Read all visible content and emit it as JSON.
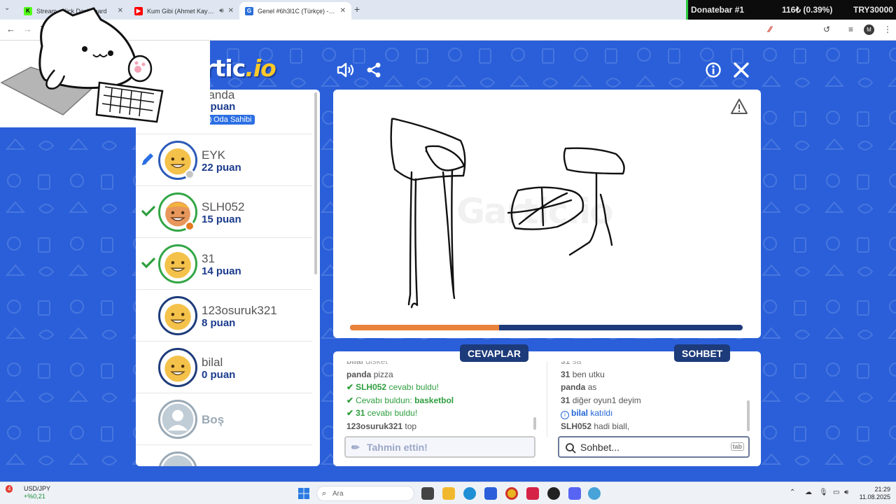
{
  "browser": {
    "tabs": [
      {
        "title": "Stream - Kick Dashboard",
        "favicon_color": "#53fc18",
        "favicon_glyph": "K"
      },
      {
        "title": "Kum Gibi (Ahmet Kaya) - Yo",
        "favicon_color": "#ff0000",
        "favicon_glyph": "▶"
      },
      {
        "title": "Genel #6h3l1C (Türkçe) - Gartic",
        "favicon_color": "#2a6fd9",
        "favicon_glyph": "G"
      }
    ],
    "new_tab": "+",
    "profile_initial": "M"
  },
  "donate": {
    "label": "Donatebar #1",
    "amount": "116₺ (0.39%)",
    "goal": "TRY30000"
  },
  "game": {
    "logo_main": "Gartic",
    "logo_suffix": ".io",
    "watermark": "Gartic.io",
    "progress_fraction": 0.38,
    "colors": {
      "accent": "#2a5fd9",
      "navy": "#1d3b7a",
      "progress": "#e9823a",
      "correct": "#2e9e3e"
    }
  },
  "players": [
    {
      "name": "panda",
      "score": "4 puan",
      "owner_label": "Oda Sahibi",
      "status": "none",
      "badge_color": "#f2c20c"
    },
    {
      "name": "EYK",
      "score": "22 puan",
      "status": "drawing",
      "badge_color": "#c5c5c5"
    },
    {
      "name": "SLH052",
      "score": "15 puan",
      "status": "guessed",
      "badge_color": "#e27b1f"
    },
    {
      "name": "31",
      "score": "14 puan",
      "status": "guessed",
      "badge_color": ""
    },
    {
      "name": "123osuruk321",
      "score": "8 puan",
      "status": "none",
      "badge_color": ""
    },
    {
      "name": "bilal",
      "score": "0 puan",
      "status": "none",
      "badge_color": ""
    },
    {
      "name": "Boş",
      "score": "",
      "status": "empty",
      "badge_color": ""
    }
  ],
  "answers": {
    "title": "CEVAPLAR",
    "lines": [
      {
        "user": "bilal",
        "text": "disket",
        "type": "faded"
      },
      {
        "user": "panda",
        "text": "pizza",
        "type": "msg"
      },
      {
        "user": "SLH052",
        "text": "cevabı buldu!",
        "type": "found"
      },
      {
        "user": "",
        "text": "Cevabı buldun: ",
        "answer": "basketbol",
        "type": "self"
      },
      {
        "user": "31",
        "text": "cevabı buldu!",
        "type": "found"
      },
      {
        "user": "123osuruk321",
        "text": "top",
        "type": "msg"
      }
    ],
    "placeholder": "Tahmin ettin!"
  },
  "chat": {
    "title": "SOHBET",
    "lines": [
      {
        "user": "31",
        "text": "sa",
        "type": "faded"
      },
      {
        "user": "31",
        "text": "ben utku",
        "type": "msg"
      },
      {
        "user": "panda",
        "text": "as",
        "type": "msg"
      },
      {
        "user": "31",
        "text": "diğer oyun1 deyim",
        "type": "msg"
      },
      {
        "user": "bilal",
        "text": "katıldı",
        "type": "join"
      },
      {
        "user": "SLH052",
        "text": "hadi biall,",
        "type": "msg"
      }
    ],
    "placeholder": "Sohbet...",
    "tab_hint": "tab"
  },
  "taskbar": {
    "stock_symbol": "USD/JPY",
    "stock_change": "+%0,21",
    "notification_count": "4",
    "search_label": "Ara",
    "time": "21:29",
    "date": "11.08.2025"
  },
  "icons": [
    "volume-icon",
    "share-icon",
    "info-icon",
    "close-icon",
    "warning-icon",
    "pencil-icon",
    "check-icon",
    "search-icon"
  ]
}
